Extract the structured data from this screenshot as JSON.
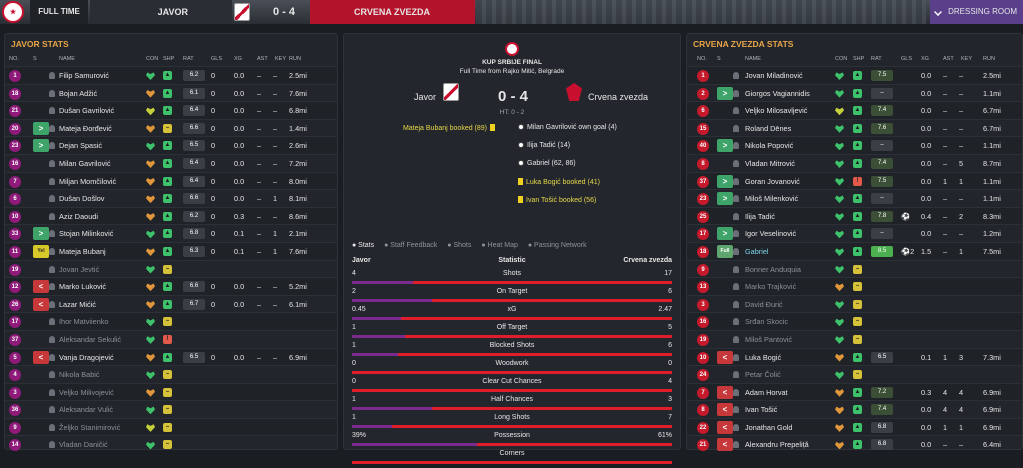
{
  "header": {
    "status": "FULL TIME",
    "home_team": "JAVOR",
    "score": "0 - 4",
    "away_team": "CRVENA ZVEZDA",
    "dressing_room": "DRESSING ROOM"
  },
  "left_panel": {
    "title": "JAVOR STATS",
    "columns": [
      "NO.",
      "S",
      "NAME",
      "CON",
      "SHP",
      "RAT",
      "GLS",
      "XG",
      "AST",
      "KEY",
      "RUN"
    ],
    "players": [
      {
        "no": "1",
        "sub": "",
        "name": "Filip Samurović",
        "con": "g",
        "shp": "g",
        "rat": "6.2",
        "gls": "0",
        "xg": "0.0",
        "ast": "–",
        "key": "–",
        "run": "2.5mi",
        "dim": false
      },
      {
        "no": "18",
        "sub": "",
        "name": "Bojan Adžić",
        "con": "o",
        "shp": "g",
        "rat": "6.1",
        "gls": "0",
        "xg": "0.0",
        "ast": "–",
        "key": "–",
        "run": "7.6mi",
        "dim": false
      },
      {
        "no": "21",
        "sub": "",
        "name": "Dušan Gavrilović",
        "con": "y",
        "shp": "g",
        "rat": "6.4",
        "gls": "0",
        "xg": "0.0",
        "ast": "–",
        "key": "–",
        "run": "6.8mi",
        "dim": false
      },
      {
        "no": "20",
        "sub": "in",
        "name": "Mateja Đorđević",
        "con": "o",
        "shp": "y",
        "rat": "6.6",
        "gls": "0",
        "xg": "0.0",
        "ast": "–",
        "key": "–",
        "run": "1.4mi",
        "dim": false
      },
      {
        "no": "23",
        "sub": "in",
        "name": "Dejan Spasić",
        "con": "g",
        "shp": "g",
        "rat": "6.5",
        "gls": "0",
        "xg": "0.0",
        "ast": "–",
        "key": "–",
        "run": "2.6mi",
        "dim": false
      },
      {
        "no": "16",
        "sub": "",
        "name": "Milan Gavrilović",
        "con": "o",
        "shp": "g",
        "rat": "6.4",
        "gls": "0",
        "xg": "0.0",
        "ast": "–",
        "key": "–",
        "run": "7.2mi",
        "dim": false
      },
      {
        "no": "7",
        "sub": "",
        "name": "Miljan Momčilović",
        "con": "o",
        "shp": "g",
        "rat": "6.4",
        "gls": "0",
        "xg": "0.0",
        "ast": "–",
        "key": "–",
        "run": "8.0mi",
        "dim": false
      },
      {
        "no": "6",
        "sub": "",
        "name": "Dušan Došlov",
        "con": "o",
        "shp": "g",
        "rat": "6.6",
        "gls": "0",
        "xg": "0.0",
        "ast": "–",
        "key": "1",
        "run": "8.1mi",
        "dim": false
      },
      {
        "no": "10",
        "sub": "",
        "name": "Aziz Daoudi",
        "con": "o",
        "shp": "g",
        "rat": "6.2",
        "gls": "0",
        "xg": "0.3",
        "ast": "–",
        "key": "–",
        "run": "8.6mi",
        "dim": false
      },
      {
        "no": "33",
        "sub": "in",
        "name": "Stojan Milinković",
        "con": "g",
        "shp": "g",
        "rat": "6.8",
        "gls": "0",
        "xg": "0.1",
        "ast": "–",
        "key": "1",
        "run": "2.1mi",
        "dim": false
      },
      {
        "no": "11",
        "sub": "yel",
        "name": "Mateja Bubanj",
        "con": "o",
        "shp": "g",
        "rat": "6.3",
        "gls": "0",
        "xg": "0.1",
        "ast": "–",
        "key": "1",
        "run": "7.6mi",
        "dim": false
      },
      {
        "no": "19",
        "sub": "",
        "name": "Jovan Jevtić",
        "con": "g",
        "shp": "y",
        "rat": "",
        "gls": "",
        "xg": "",
        "ast": "",
        "key": "",
        "run": "",
        "dim": true
      },
      {
        "no": "12",
        "sub": "out",
        "name": "Marko Luković",
        "con": "o",
        "shp": "g",
        "rat": "6.6",
        "gls": "0",
        "xg": "0.0",
        "ast": "–",
        "key": "–",
        "run": "5.2mi",
        "dim": false
      },
      {
        "no": "26",
        "sub": "out",
        "name": "Lazar Mićić",
        "con": "o",
        "shp": "g",
        "rat": "6.7",
        "gls": "0",
        "xg": "0.0",
        "ast": "–",
        "key": "–",
        "run": "6.1mi",
        "dim": false
      },
      {
        "no": "17",
        "sub": "",
        "name": "Ihor Matviienko",
        "con": "g",
        "shp": "y",
        "rat": "",
        "gls": "",
        "xg": "",
        "ast": "",
        "key": "",
        "run": "",
        "dim": true
      },
      {
        "no": "37",
        "sub": "",
        "name": "Aleksandar Sekulić",
        "con": "g",
        "shp": "r",
        "rat": "",
        "gls": "",
        "xg": "",
        "ast": "",
        "key": "",
        "run": "",
        "dim": true
      },
      {
        "no": "5",
        "sub": "out",
        "name": "Vanja Dragojević",
        "con": "o",
        "shp": "g",
        "rat": "6.5",
        "gls": "0",
        "xg": "0.0",
        "ast": "–",
        "key": "–",
        "run": "6.9mi",
        "dim": false
      },
      {
        "no": "4",
        "sub": "",
        "name": "Nikola Babić",
        "con": "g",
        "shp": "y",
        "rat": "",
        "gls": "",
        "xg": "",
        "ast": "",
        "key": "",
        "run": "",
        "dim": true
      },
      {
        "no": "3",
        "sub": "",
        "name": "Veljko Milivojević",
        "con": "o",
        "shp": "y",
        "rat": "",
        "gls": "",
        "xg": "",
        "ast": "",
        "key": "",
        "run": "",
        "dim": true
      },
      {
        "no": "36",
        "sub": "",
        "name": "Aleksandar Vulić",
        "con": "g",
        "shp": "y",
        "rat": "",
        "gls": "",
        "xg": "",
        "ast": "",
        "key": "",
        "run": "",
        "dim": true
      },
      {
        "no": "9",
        "sub": "",
        "name": "Željko Stanimirović",
        "con": "y",
        "shp": "y",
        "rat": "",
        "gls": "",
        "xg": "",
        "ast": "",
        "key": "",
        "run": "",
        "dim": true
      },
      {
        "no": "14",
        "sub": "",
        "name": "Vladan Daničić",
        "con": "g",
        "shp": "y",
        "rat": "",
        "gls": "",
        "xg": "",
        "ast": "",
        "key": "",
        "run": "",
        "dim": true
      }
    ]
  },
  "right_panel": {
    "title": "CRVENA ZVEZDA STATS",
    "columns": [
      "NO.",
      "S",
      "NAME",
      "CON",
      "SHP",
      "RAT",
      "GLS",
      "XG",
      "AST",
      "KEY",
      "RUN"
    ],
    "players": [
      {
        "no": "1",
        "sub": "",
        "name": "Jovan Miladinović",
        "con": "g",
        "shp": "g",
        "rat": "7.5",
        "rc": "d",
        "gls": "",
        "xg": "0.0",
        "ast": "–",
        "key": "–",
        "run": "2.5mi",
        "dim": false,
        "hl": false
      },
      {
        "no": "2",
        "sub": "in",
        "name": "Giorgos Vagiannidis",
        "con": "g",
        "shp": "g",
        "rat": "–",
        "rc": "n",
        "gls": "",
        "xg": "0.0",
        "ast": "–",
        "key": "–",
        "run": "1.1mi",
        "dim": false,
        "hl": false
      },
      {
        "no": "6",
        "sub": "",
        "name": "Veljko Milosavljević",
        "con": "y",
        "shp": "g",
        "rat": "7.4",
        "rc": "d",
        "gls": "",
        "xg": "0.0",
        "ast": "–",
        "key": "–",
        "run": "6.7mi",
        "dim": false,
        "hl": false
      },
      {
        "no": "15",
        "sub": "",
        "name": "Roland Dēnes",
        "con": "g",
        "shp": "g",
        "rat": "7.6",
        "rc": "d",
        "gls": "",
        "xg": "0.0",
        "ast": "–",
        "key": "–",
        "run": "6.7mi",
        "dim": false,
        "hl": false
      },
      {
        "no": "40",
        "sub": "in",
        "name": "Nikola Popović",
        "con": "g",
        "shp": "g",
        "rat": "–",
        "rc": "n",
        "gls": "",
        "xg": "0.0",
        "ast": "–",
        "key": "–",
        "run": "1.1mi",
        "dim": false,
        "hl": false
      },
      {
        "no": "8",
        "sub": "",
        "name": "Vladan Mitrović",
        "con": "g",
        "shp": "g",
        "rat": "7.4",
        "rc": "d",
        "gls": "",
        "xg": "0.0",
        "ast": "–",
        "key": "5",
        "run": "8.7mi",
        "dim": false,
        "hl": false
      },
      {
        "no": "37",
        "sub": "in",
        "name": "Goran Jovanović",
        "con": "g",
        "shp": "r",
        "rat": "7.5",
        "rc": "d",
        "gls": "",
        "xg": "0.0",
        "ast": "1",
        "key": "1",
        "run": "1.1mi",
        "dim": false,
        "hl": false
      },
      {
        "no": "23",
        "sub": "in",
        "name": "Miloš Milenković",
        "con": "g",
        "shp": "g",
        "rat": "–",
        "rc": "n",
        "gls": "",
        "xg": "0.0",
        "ast": "–",
        "key": "–",
        "run": "1.1mi",
        "dim": false,
        "hl": false
      },
      {
        "no": "25",
        "sub": "",
        "name": "Ilija Tadić",
        "con": "g",
        "shp": "g",
        "rat": "7.8",
        "rc": "d",
        "gls": "⚽",
        "xg": "0.4",
        "ast": "–",
        "key": "2",
        "run": "8.3mi",
        "dim": false,
        "hl": false
      },
      {
        "no": "17",
        "sub": "in",
        "name": "Igor Veselinović",
        "con": "g",
        "shp": "g",
        "rat": "–",
        "rc": "n",
        "gls": "",
        "xg": "0.0",
        "ast": "–",
        "key": "–",
        "run": "1.2mi",
        "dim": false,
        "hl": false
      },
      {
        "no": "18",
        "sub": "full",
        "name": "Gabriel",
        "con": "g",
        "shp": "g",
        "rat": "8.5",
        "rc": "g",
        "gls": "⚽2",
        "xg": "1.5",
        "ast": "–",
        "key": "1",
        "run": "7.5mi",
        "dim": false,
        "hl": true
      },
      {
        "no": "9",
        "sub": "",
        "name": "Bonner Anduquia",
        "con": "g",
        "shp": "y",
        "rat": "",
        "rc": "",
        "gls": "",
        "xg": "",
        "ast": "",
        "key": "",
        "run": "",
        "dim": true,
        "hl": false
      },
      {
        "no": "13",
        "sub": "",
        "name": "Marko Trajković",
        "con": "o",
        "shp": "y",
        "rat": "",
        "rc": "",
        "gls": "",
        "xg": "",
        "ast": "",
        "key": "",
        "run": "",
        "dim": true,
        "hl": false
      },
      {
        "no": "3",
        "sub": "",
        "name": "David Đurić",
        "con": "g",
        "shp": "y",
        "rat": "",
        "rc": "",
        "gls": "",
        "xg": "",
        "ast": "",
        "key": "",
        "run": "",
        "dim": true,
        "hl": false
      },
      {
        "no": "16",
        "sub": "",
        "name": "Srđan Skocic",
        "con": "g",
        "shp": "y",
        "rat": "",
        "rc": "",
        "gls": "",
        "xg": "",
        "ast": "",
        "key": "",
        "run": "",
        "dim": true,
        "hl": false
      },
      {
        "no": "19",
        "sub": "",
        "name": "Miloš Pantović",
        "con": "g",
        "shp": "y",
        "rat": "",
        "rc": "",
        "gls": "",
        "xg": "",
        "ast": "",
        "key": "",
        "run": "",
        "dim": true,
        "hl": false
      },
      {
        "no": "10",
        "sub": "out",
        "name": "Luka Bogić",
        "con": "o",
        "shp": "g",
        "rat": "6.5",
        "rc": "n",
        "gls": "",
        "xg": "0.1",
        "ast": "1",
        "key": "3",
        "run": "7.3mi",
        "dim": false,
        "hl": false
      },
      {
        "no": "24",
        "sub": "",
        "name": "Petar Čolić",
        "con": "g",
        "shp": "y",
        "rat": "",
        "rc": "",
        "gls": "",
        "xg": "",
        "ast": "",
        "key": "",
        "run": "",
        "dim": true,
        "hl": false
      },
      {
        "no": "7",
        "sub": "out",
        "name": "Adam Horvat",
        "con": "o",
        "shp": "g",
        "rat": "7.2",
        "rc": "d",
        "gls": "",
        "xg": "0.3",
        "ast": "4",
        "key": "4",
        "run": "6.9mi",
        "dim": false,
        "hl": false
      },
      {
        "no": "8",
        "sub": "out",
        "name": "Ivan Tošić",
        "con": "o",
        "shp": "g",
        "rat": "7.4",
        "rc": "d",
        "gls": "",
        "xg": "0.0",
        "ast": "4",
        "key": "4",
        "run": "6.9mi",
        "dim": false,
        "hl": false
      },
      {
        "no": "22",
        "sub": "out",
        "name": "Jonathan Gold",
        "con": "o",
        "shp": "g",
        "rat": "6.8",
        "rc": "n",
        "gls": "",
        "xg": "0.0",
        "ast": "1",
        "key": "1",
        "run": "6.9mi",
        "dim": false,
        "hl": false
      },
      {
        "no": "21",
        "sub": "out",
        "name": "Alexandru Prepeliță",
        "con": "o",
        "shp": "g",
        "rat": "6.8",
        "rc": "n",
        "gls": "",
        "xg": "0.0",
        "ast": "–",
        "key": "–",
        "run": "6.4mi",
        "dim": false,
        "hl": false
      }
    ]
  },
  "match": {
    "competition": "KUP SRBIJE FINAL",
    "venue": "Full Time from Rajko Mitić, Belgrade",
    "home": "Javor",
    "away": "Crvena zvezda",
    "score": "0 - 4",
    "ht": "HT: 0 - 2",
    "home_events": [
      {
        "text": "Mateja Bubanj booked (89)",
        "type": "card",
        "hl": true
      }
    ],
    "away_events": [
      {
        "text": "Milan Gavrilović own goal (4)",
        "type": "goal",
        "hl": false
      },
      {
        "text": "Ilija Tadić (14)",
        "type": "goal",
        "hl": false
      },
      {
        "text": "Gabriel (62, 86)",
        "type": "goal",
        "hl": false
      },
      {
        "text": "Luka Bogić booked (41)",
        "type": "card",
        "hl": true
      },
      {
        "text": "Ivan Tošić booked (56)",
        "type": "card",
        "hl": true
      }
    ],
    "tabs": [
      "Stats",
      "Staff Feedback",
      "Shots",
      "Heat Map",
      "Passing Network"
    ],
    "stats_header": {
      "home": "Javor",
      "center": "Statistic",
      "away": "Crvena zvezda"
    },
    "stats": [
      {
        "label": "Shots",
        "home": "4",
        "away": "17",
        "hv": 4,
        "av": 17
      },
      {
        "label": "On Target",
        "home": "2",
        "away": "6",
        "hv": 2,
        "av": 6
      },
      {
        "label": "xG",
        "home": "0.45",
        "away": "2.47",
        "hv": 0.45,
        "av": 2.47
      },
      {
        "label": "Off Target",
        "home": "1",
        "away": "5",
        "hv": 1,
        "av": 5
      },
      {
        "label": "Blocked Shots",
        "home": "1",
        "away": "6",
        "hv": 1,
        "av": 6
      },
      {
        "label": "Woodwork",
        "home": "0",
        "away": "0",
        "hv": 0,
        "av": 0
      },
      {
        "label": "Clear Cut Chances",
        "home": "0",
        "away": "4",
        "hv": 0,
        "av": 4
      },
      {
        "label": "Half Chances",
        "home": "1",
        "away": "3",
        "hv": 1,
        "av": 3
      },
      {
        "label": "Long Shots",
        "home": "1",
        "away": "7",
        "hv": 1,
        "av": 7
      },
      {
        "label": "Possession",
        "home": "39%",
        "away": "61%",
        "hv": 39,
        "av": 61
      },
      {
        "label": "Corners",
        "home": "",
        "away": "",
        "hv": 0,
        "av": 0
      }
    ]
  }
}
